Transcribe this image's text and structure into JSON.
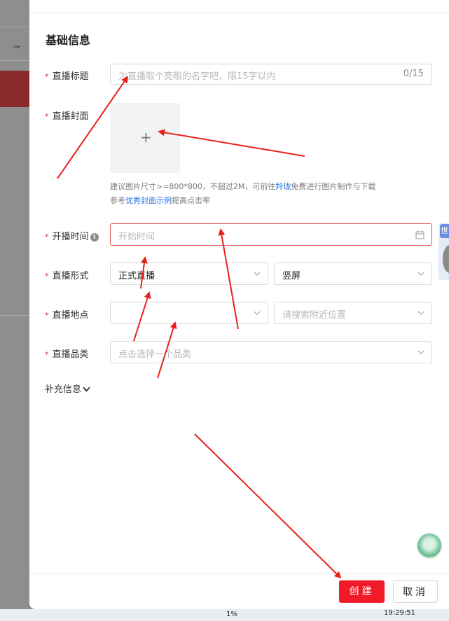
{
  "form": {
    "section_title": "基础信息",
    "title": {
      "label": "直播标题",
      "placeholder": "为直播取个亮眼的名字吧，限15字以内",
      "counter": "0/15"
    },
    "cover": {
      "label": "直播封面",
      "hint_line1_pre": "建议图片尺寸>=800*800，不超过2M，可前往",
      "hint_line1_link": "羚珑",
      "hint_line1_post": "免费进行图片制作与下载",
      "hint_line2_pre": "参考",
      "hint_line2_link": "优秀封面示例",
      "hint_line2_post": "提高点击率"
    },
    "start_time": {
      "label": "开播时间",
      "placeholder": "开始时间"
    },
    "format": {
      "label": "直播形式",
      "type_value": "正式直播",
      "orientation_value": "竖屏"
    },
    "location": {
      "label": "直播地点",
      "city_value": "",
      "nearby_placeholder": "请搜索附近位置"
    },
    "category": {
      "label": "直播品类",
      "placeholder": "点击选择一个品类"
    },
    "more_info": "补充信息"
  },
  "footer": {
    "create": "创建",
    "cancel": "取消"
  },
  "side_widget": {
    "label": "世"
  },
  "taskbar": {
    "clock": "19:29:51",
    "battery": "1%"
  },
  "colors": {
    "primary_red": "#f01a28",
    "link_blue": "#1e73e8",
    "required_red": "#e02e2e",
    "annotation_arrow": "#e8201a"
  }
}
